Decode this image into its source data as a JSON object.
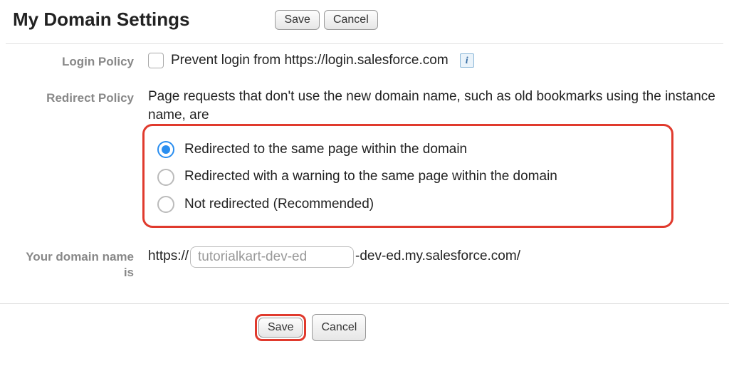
{
  "page": {
    "title": "My Domain Settings",
    "save_label": "Save",
    "cancel_label": "Cancel"
  },
  "login_policy": {
    "label": "Login Policy",
    "prevent_text": "Prevent login from https://login.salesforce.com",
    "prevent_checked": false,
    "info": "i"
  },
  "redirect_policy": {
    "label": "Redirect Policy",
    "intro": "Page requests that don't use the new domain name, such as old bookmarks using the instance name, are",
    "options": [
      "Redirected to the same page within the domain",
      "Redirected with a warning to the same page within the domain",
      "Not redirected (Recommended)"
    ],
    "selected_index": 0
  },
  "domain_name": {
    "label": "Your domain name is",
    "prefix": "https://",
    "value": "tutorialkart-dev-ed",
    "suffix": "-dev-ed.my.salesforce.com/"
  },
  "footer": {
    "save_label": "Save",
    "cancel_label": "Cancel"
  }
}
